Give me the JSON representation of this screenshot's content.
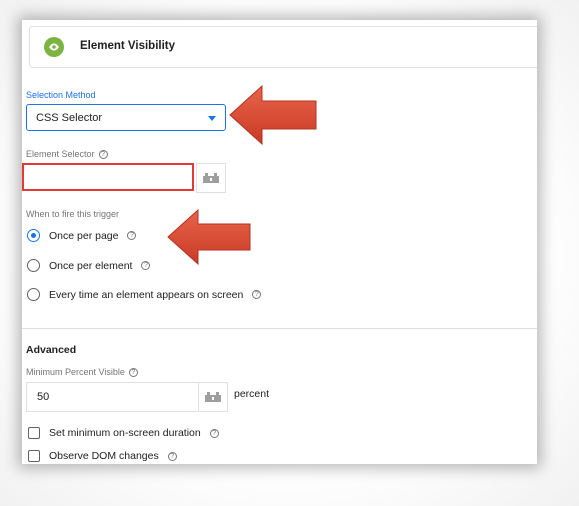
{
  "header": {
    "title": "Element Visibility",
    "icon": "eye-icon"
  },
  "selection_method": {
    "label": "Selection Method",
    "value": "CSS Selector"
  },
  "element_selector": {
    "label": "Element Selector",
    "value": "",
    "help_icon": "help-icon"
  },
  "fire": {
    "label": "When to fire this trigger",
    "options": [
      {
        "label": "Once per page",
        "checked": true
      },
      {
        "label": "Once per element",
        "checked": false
      },
      {
        "label": "Every time an element appears on screen",
        "checked": false
      }
    ]
  },
  "advanced": {
    "title": "Advanced",
    "min_percent_label": "Minimum Percent Visible",
    "min_percent_value": "50",
    "min_percent_suffix": "percent",
    "checkboxes": [
      {
        "label": "Set minimum on-screen duration",
        "checked": false
      },
      {
        "label": "Observe DOM changes",
        "checked": false
      }
    ]
  },
  "colors": {
    "accent": "#1a73e8",
    "highlight_border": "#e53935",
    "arrow": "#d9432f",
    "badge": "#7cb342"
  }
}
